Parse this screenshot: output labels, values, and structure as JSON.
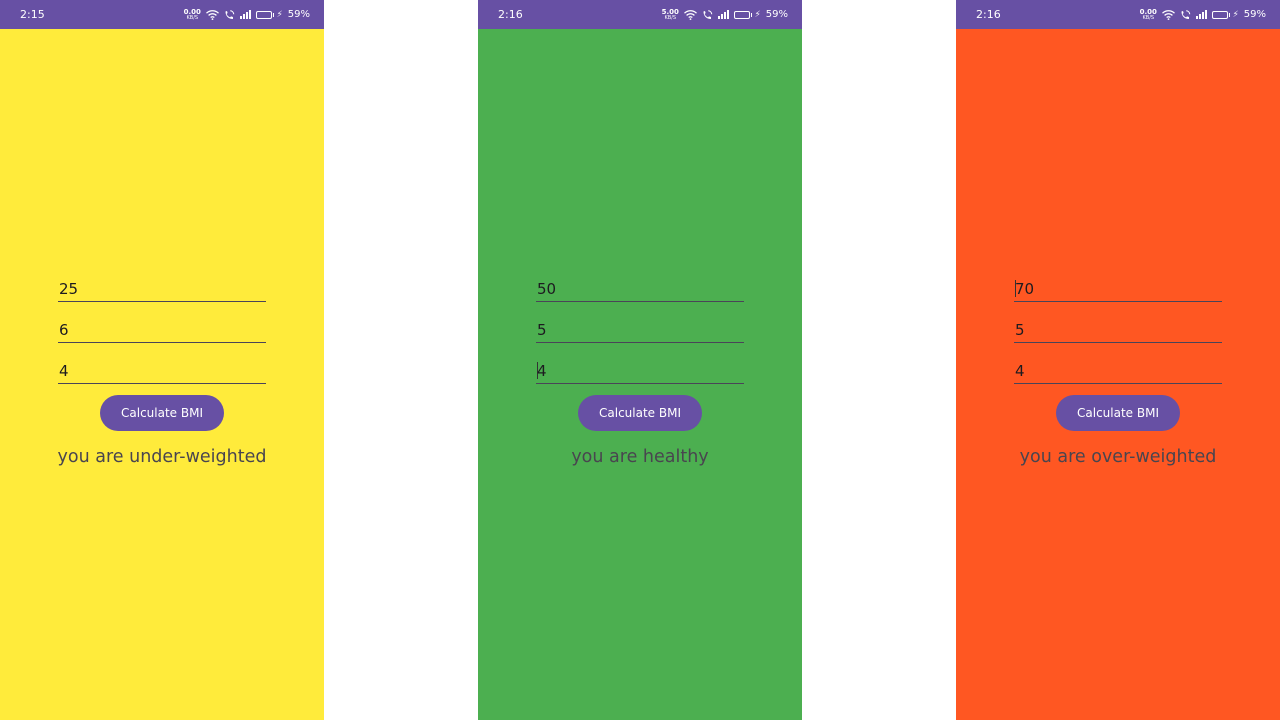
{
  "screens": [
    {
      "background": "#ffeb3b",
      "status": {
        "time": "2:15",
        "net_speed": "0.00",
        "net_unit": "KB/S",
        "battery_level": 0.59,
        "battery_pct": "59%"
      },
      "inputs": [
        {
          "value": "25"
        },
        {
          "value": "6"
        },
        {
          "value": "4"
        }
      ],
      "button_label": "Calculate BMI",
      "result": "you are under-weighted"
    },
    {
      "background": "#4caf50",
      "status": {
        "time": "2:16",
        "net_speed": "5.00",
        "net_unit": "KB/S",
        "battery_level": 0.59,
        "battery_pct": "59%"
      },
      "inputs": [
        {
          "value": "50"
        },
        {
          "value": "5"
        },
        {
          "value": "4"
        }
      ],
      "button_label": "Calculate BMI",
      "result": "you are healthy"
    },
    {
      "background": "#ff5722",
      "status": {
        "time": "2:16",
        "net_speed": "0.00",
        "net_unit": "KB/S",
        "battery_level": 0.59,
        "battery_pct": "59%"
      },
      "inputs": [
        {
          "value": "70"
        },
        {
          "value": "5"
        },
        {
          "value": "4"
        }
      ],
      "button_label": "Calculate BMI",
      "result": "you are over-weighted"
    }
  ],
  "colors": {
    "status_bar": "#6750a4",
    "button": "#6750a4",
    "button_text": "#ffffff",
    "result_text": "#49454f",
    "underline": "#4a4458"
  },
  "icons": [
    "wifi-icon",
    "wifi-calling-icon",
    "signal-icon",
    "battery-icon",
    "charging-bolt-icon"
  ]
}
